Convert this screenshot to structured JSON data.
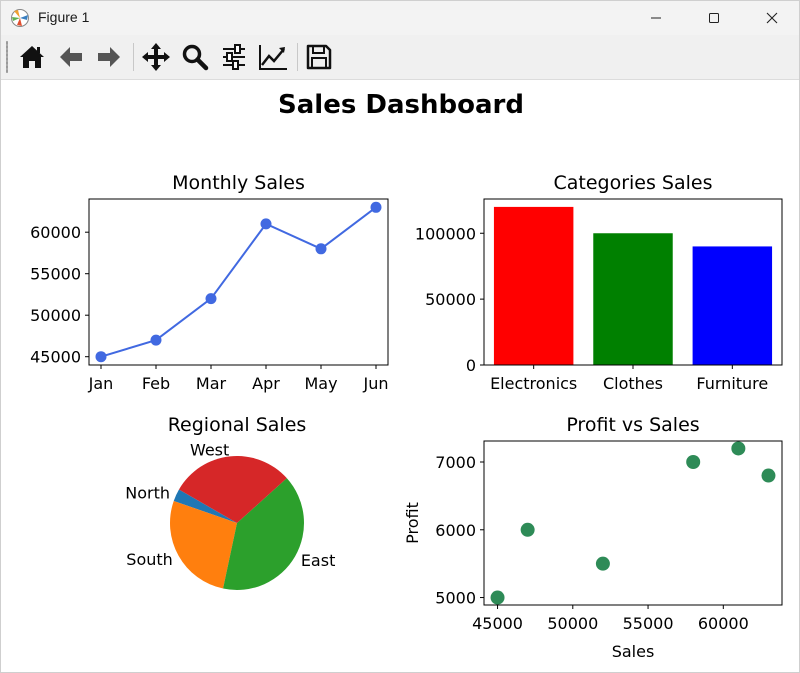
{
  "window": {
    "title": "Figure 1",
    "app_icon": "matplotlib-icon",
    "controls": [
      "minimize-icon",
      "maximize-icon",
      "close-icon"
    ]
  },
  "toolbar": {
    "buttons": [
      {
        "name": "home-icon",
        "label": "Home"
      },
      {
        "name": "back-icon",
        "label": "Back"
      },
      {
        "name": "forward-icon",
        "label": "Forward"
      },
      {
        "name": "pan-icon",
        "label": "Pan"
      },
      {
        "name": "zoom-icon",
        "label": "Zoom"
      },
      {
        "name": "configure-subplots-icon",
        "label": "Subplots"
      },
      {
        "name": "edit-axis-icon",
        "label": "Customize"
      },
      {
        "name": "save-icon",
        "label": "Save"
      }
    ]
  },
  "figure": {
    "suptitle": "Sales Dashboard"
  },
  "chart_data": [
    {
      "type": "line",
      "title": "Monthly Sales",
      "xlabel": "",
      "ylabel": "",
      "categories": [
        "Jan",
        "Feb",
        "Mar",
        "Apr",
        "May",
        "Jun"
      ],
      "values": [
        45000,
        47000,
        52000,
        61000,
        58000,
        63000
      ],
      "ylim": [
        44000,
        64000
      ],
      "yticks": [
        45000,
        50000,
        55000,
        60000
      ],
      "color": "#4169e1",
      "marker": "circle",
      "grid": false
    },
    {
      "type": "bar",
      "title": "Categories Sales",
      "xlabel": "",
      "ylabel": "",
      "categories": [
        "Electronics",
        "Clothes",
        "Furniture"
      ],
      "values": [
        120000,
        100000,
        90000
      ],
      "colors": [
        "#ff0000",
        "#008000",
        "#0000ff"
      ],
      "ylim": [
        0,
        126000
      ],
      "yticks": [
        0,
        50000,
        100000
      ],
      "grid": false
    },
    {
      "type": "pie",
      "title": "Regional Sales",
      "labels": [
        "North",
        "South",
        "East",
        "West"
      ],
      "values": [
        3,
        27,
        40,
        30
      ],
      "colors": [
        "#1f77b4",
        "#ff7f0e",
        "#2ca02c",
        "#d62728"
      ],
      "startangle": 150
    },
    {
      "type": "scatter",
      "title": "Profit vs Sales",
      "xlabel": "Sales",
      "ylabel": "Profit",
      "x": [
        45000,
        47000,
        52000,
        58000,
        61000,
        63000
      ],
      "y": [
        5000,
        6000,
        5500,
        7000,
        7200,
        6800
      ],
      "xlim": [
        44100,
        63900
      ],
      "ylim": [
        4890,
        7310
      ],
      "xticks": [
        45000,
        50000,
        55000,
        60000
      ],
      "yticks": [
        5000,
        6000,
        7000
      ],
      "color": "#2e8b57",
      "grid": false
    }
  ]
}
